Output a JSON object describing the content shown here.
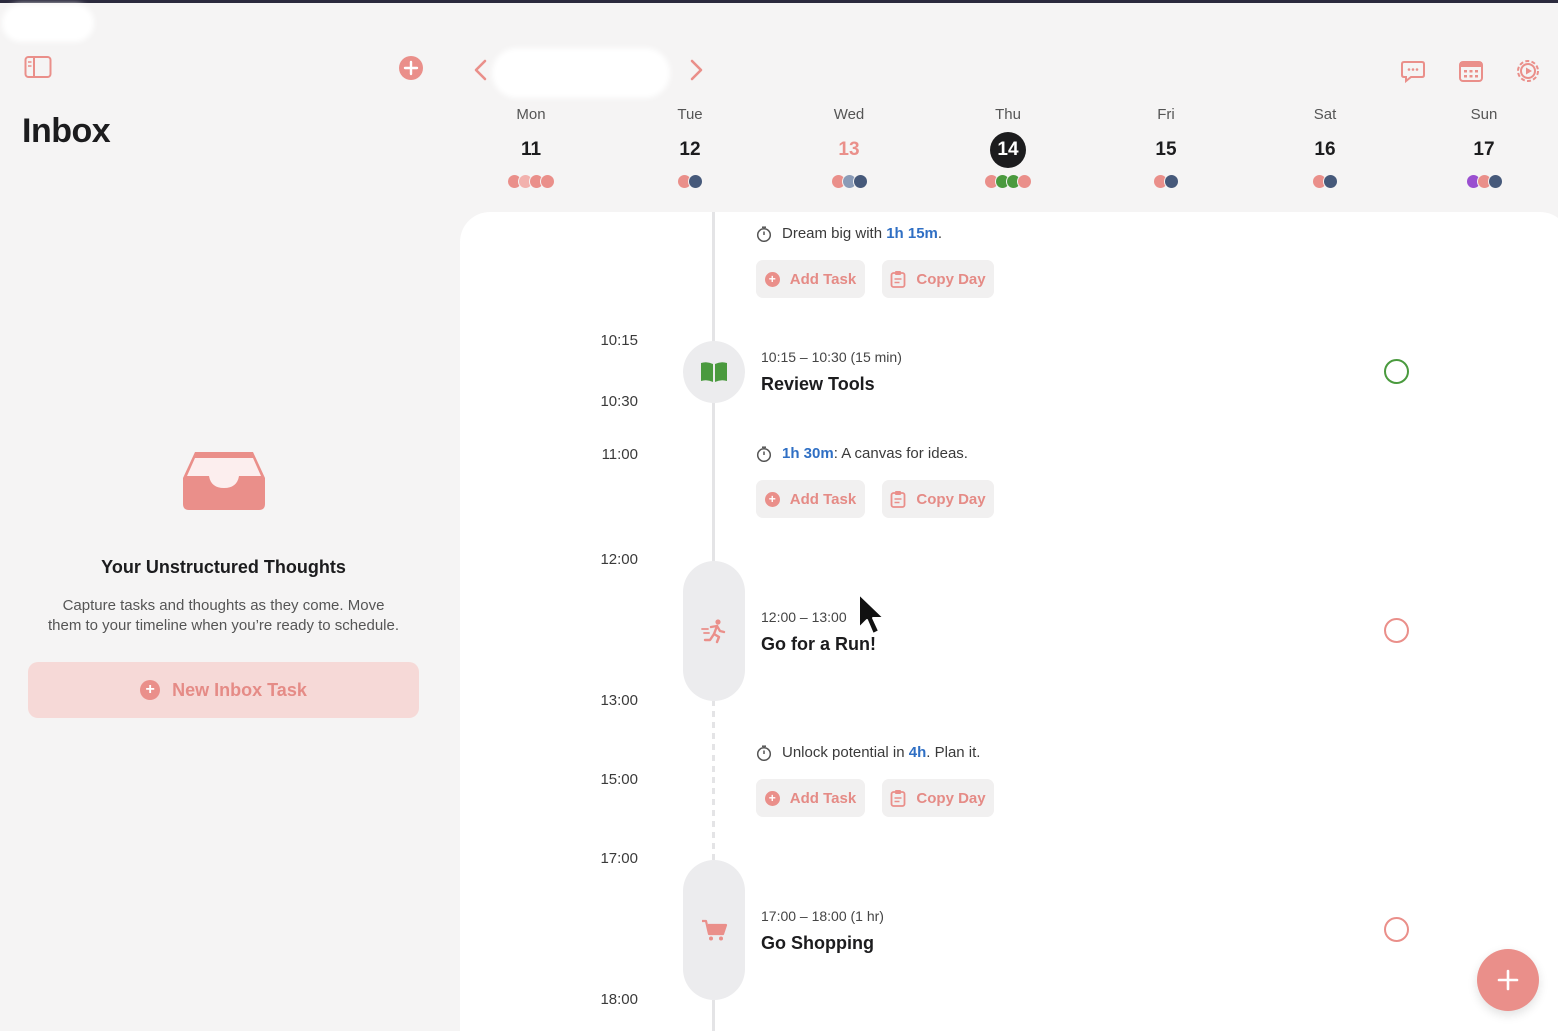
{
  "sidebar": {
    "title": "Inbox",
    "empty_title": "Your Unstructured Thoughts",
    "empty_desc_line1": "Capture tasks and thoughts as they come. Move",
    "empty_desc_line2": "them to your timeline when you’re ready to schedule.",
    "new_task_label": "New Inbox Task"
  },
  "week": [
    {
      "name": "Mon",
      "num": "11",
      "style": "normal",
      "dots": [
        "#ea8f8a",
        "#f2b1ad",
        "#ea8f8a",
        "#ea8f8a"
      ]
    },
    {
      "name": "Tue",
      "num": "12",
      "style": "normal",
      "dots": [
        "#ea8f8a",
        "#46597a"
      ]
    },
    {
      "name": "Wed",
      "num": "13",
      "style": "red",
      "dots": [
        "#ea8f8a",
        "#8a9bb7",
        "#46597a"
      ]
    },
    {
      "name": "Thu",
      "num": "14",
      "style": "today",
      "dots": [
        "#ea8f8a",
        "#4a9a3e",
        "#4a9a3e",
        "#ea8f8a"
      ]
    },
    {
      "name": "Fri",
      "num": "15",
      "style": "normal",
      "dots": [
        "#ea8f8a",
        "#46597a"
      ]
    },
    {
      "name": "Sat",
      "num": "16",
      "style": "normal",
      "dots": [
        "#ea8f8a",
        "#46597a"
      ]
    },
    {
      "name": "Sun",
      "num": "17",
      "style": "normal",
      "dots": [
        "#9a4fd0",
        "#ea8f8a",
        "#46597a"
      ]
    }
  ],
  "timeline": {
    "times": [
      "10:15",
      "10:30",
      "11:00",
      "12:00",
      "13:00",
      "15:00",
      "17:00",
      "18:00"
    ],
    "gap1": {
      "pre": "Dream big with ",
      "hl": "1h 15m",
      "post": "."
    },
    "gap2": {
      "pre": "",
      "hl": "1h 30m",
      "post": ": A canvas for ideas."
    },
    "gap3": {
      "pre": "Unlock potential in ",
      "hl": "4h",
      "post": ". Plan it."
    },
    "add_task_label": "Add Task",
    "copy_day_label": "Copy Day",
    "tasks": [
      {
        "time": "10:15 – 10:30 (15 min)",
        "title": "Review Tools",
        "icon": "book-icon",
        "color": "#4a9a3e"
      },
      {
        "time": "12:00 – 13:00",
        "title": "Go for a Run!",
        "icon": "running-icon",
        "color": "#ea8f8a"
      },
      {
        "time": "17:00 – 18:00 (1 hr)",
        "title": "Go Shopping",
        "icon": "cart-icon",
        "color": "#ea8f8a"
      }
    ]
  },
  "colors": {
    "accent": "#ea8f8a",
    "accent_soft": "#f6d9d7",
    "highlight": "#2f6fc4",
    "done_green": "#4a9a3e"
  }
}
